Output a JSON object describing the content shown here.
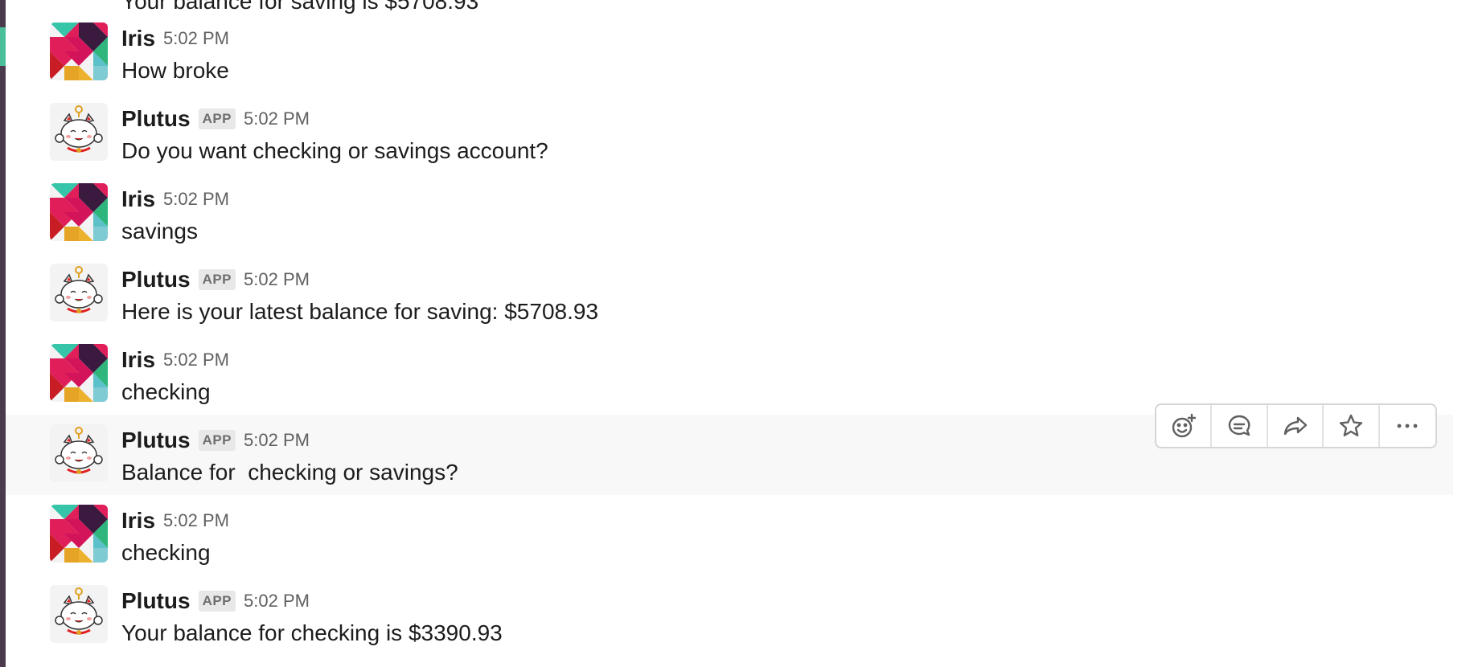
{
  "partial_message": "Your balance for saving is $5708.93",
  "messages": [
    {
      "sender": "Iris",
      "avatar": "slack-pinwheel-avatar",
      "badge": "",
      "time": "5:02 PM",
      "text": "How broke"
    },
    {
      "sender": "Plutus",
      "avatar": "lucky-cat-avatar",
      "badge": "APP",
      "time": "5:02 PM",
      "text": "Do you want checking or savings account?"
    },
    {
      "sender": "Iris",
      "avatar": "slack-pinwheel-avatar",
      "badge": "",
      "time": "5:02 PM",
      "text": "savings"
    },
    {
      "sender": "Plutus",
      "avatar": "lucky-cat-avatar",
      "badge": "APP",
      "time": "5:02 PM",
      "text": "Here is your latest balance for saving: $5708.93"
    },
    {
      "sender": "Iris",
      "avatar": "slack-pinwheel-avatar",
      "badge": "",
      "time": "5:02 PM",
      "text": "checking"
    },
    {
      "sender": "Plutus",
      "avatar": "lucky-cat-avatar",
      "badge": "APP",
      "time": "5:02 PM",
      "text": "Balance for  checking or savings?"
    },
    {
      "sender": "Iris",
      "avatar": "slack-pinwheel-avatar",
      "badge": "",
      "time": "5:02 PM",
      "text": "checking"
    },
    {
      "sender": "Plutus",
      "avatar": "lucky-cat-avatar",
      "badge": "APP",
      "time": "5:02 PM",
      "text": "Your balance for checking is $3390.93"
    }
  ],
  "hover_toolbar": {
    "icons": [
      "add-reaction-icon",
      "start-thread-icon",
      "share-message-icon",
      "star-icon",
      "more-actions-icon"
    ]
  },
  "colors": {
    "sidebar": "#4a3a4c",
    "sidebar_accent": "#4bbf9a",
    "hover_row": "#f8f8f8",
    "app_badge_bg": "#e8e8e8"
  }
}
